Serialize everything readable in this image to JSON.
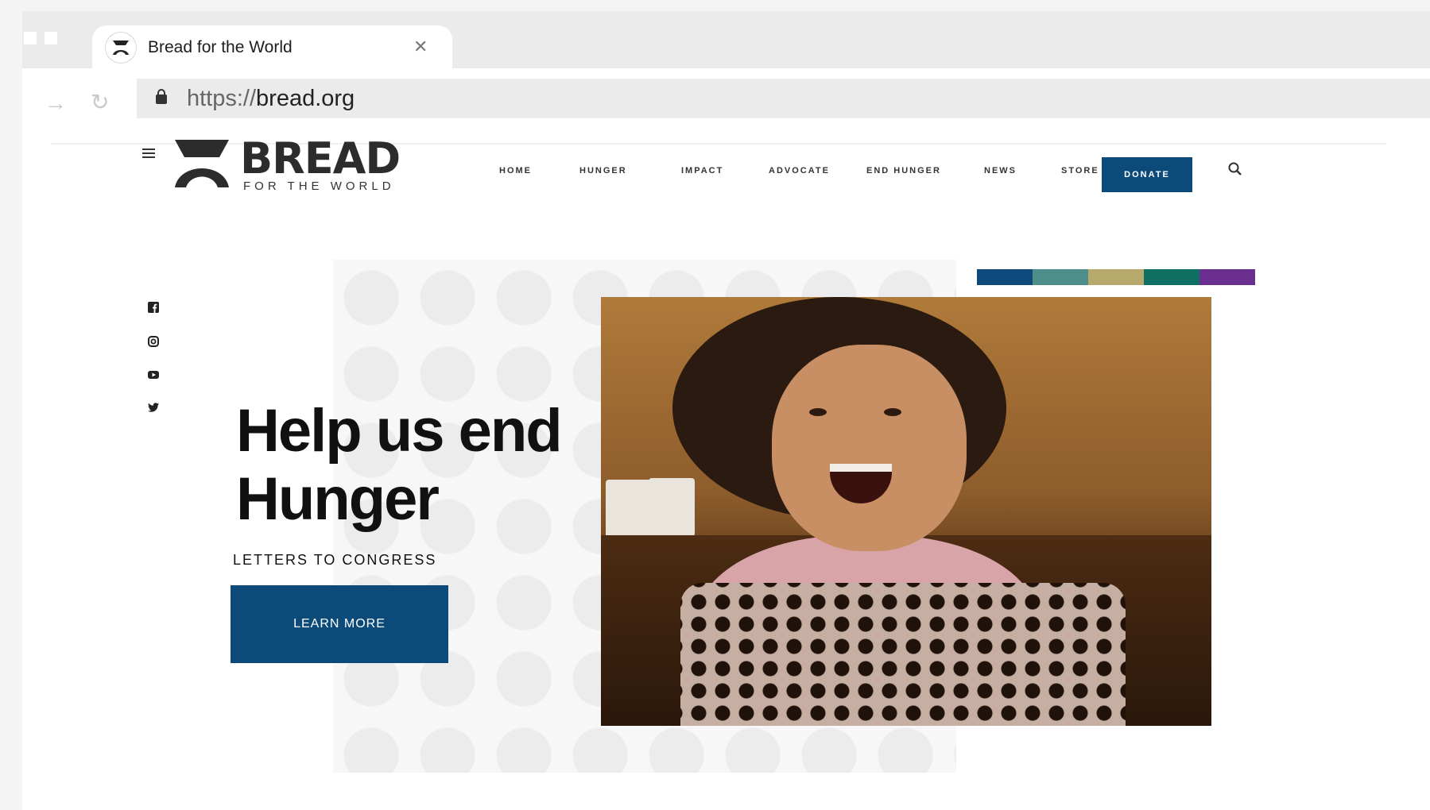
{
  "browser": {
    "tab_title": "Bread for the World",
    "url_scheme": "https://",
    "url_host": "bread.org"
  },
  "site": {
    "logo_word": "BREAD",
    "logo_sub": "FOR THE WORLD",
    "nav": [
      "HOME",
      "HUNGER",
      "IMPACT",
      "ADVOCATE",
      "END HUNGER",
      "NEWS",
      "STORE"
    ],
    "donate_label": "DONATE"
  },
  "social": [
    "facebook-icon",
    "instagram-icon",
    "youtube-icon",
    "twitter-icon"
  ],
  "hero": {
    "title": "Help us end Hunger",
    "subtitle": "LETTERS TO CONGRESS",
    "cta_label": "LEARN MORE"
  },
  "colors": {
    "brand_blue": "#0c4a7a",
    "palette": [
      "#0f4a7c",
      "#4d8e8a",
      "#b7a96b",
      "#0f6f63",
      "#6a2e8e"
    ]
  }
}
